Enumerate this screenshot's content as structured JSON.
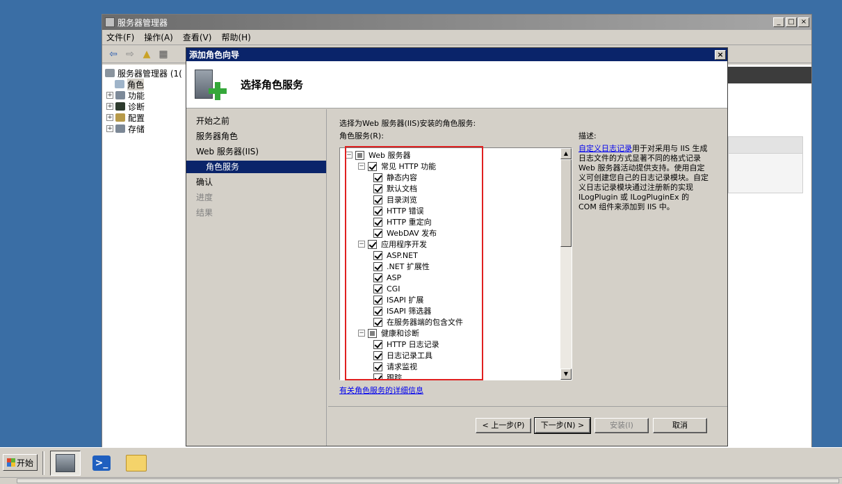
{
  "main_window": {
    "title": "服务器管理器",
    "menu": [
      "文件(F)",
      "操作(A)",
      "查看(V)",
      "帮助(H)"
    ],
    "tree": [
      {
        "label": "服务器管理器 (1(",
        "expander": ""
      },
      {
        "label": "角色",
        "expander": ""
      },
      {
        "label": "功能",
        "expander": "+"
      },
      {
        "label": "诊断",
        "expander": "+"
      },
      {
        "label": "配置",
        "expander": "+"
      },
      {
        "label": "存储",
        "expander": "+"
      }
    ]
  },
  "wizard": {
    "title": "添加角色向导",
    "close": "×",
    "header_title": "选择角色服务",
    "nav": [
      {
        "label": "开始之前",
        "state": "normal"
      },
      {
        "label": "服务器角色",
        "state": "normal"
      },
      {
        "label": "Web 服务器(IIS)",
        "state": "normal"
      },
      {
        "label": "角色服务",
        "state": "active"
      },
      {
        "label": "确认",
        "state": "normal"
      },
      {
        "label": "进度",
        "state": "disabled"
      },
      {
        "label": "结果",
        "state": "disabled"
      }
    ],
    "instruction": "选择为Web 服务器(IIS)安装的角色服务:",
    "list_label": "角色服务(R):",
    "role_services": [
      {
        "label": "Web 服务器",
        "level": 0,
        "toggle": "⊟",
        "check": "partial"
      },
      {
        "label": "常见 HTTP 功能",
        "level": 1,
        "toggle": "⊟",
        "check": "checked"
      },
      {
        "label": "静态内容",
        "level": 2,
        "toggle": "",
        "check": "checked"
      },
      {
        "label": "默认文档",
        "level": 2,
        "toggle": "",
        "check": "checked"
      },
      {
        "label": "目录浏览",
        "level": 2,
        "toggle": "",
        "check": "checked"
      },
      {
        "label": "HTTP 错误",
        "level": 2,
        "toggle": "",
        "check": "checked"
      },
      {
        "label": "HTTP 重定向",
        "level": 2,
        "toggle": "",
        "check": "checked"
      },
      {
        "label": "WebDAV 发布",
        "level": 2,
        "toggle": "",
        "check": "checked"
      },
      {
        "label": "应用程序开发",
        "level": 1,
        "toggle": "⊟",
        "check": "checked"
      },
      {
        "label": "ASP.NET",
        "level": 2,
        "toggle": "",
        "check": "checked"
      },
      {
        "label": ".NET 扩展性",
        "level": 2,
        "toggle": "",
        "check": "checked"
      },
      {
        "label": "ASP",
        "level": 2,
        "toggle": "",
        "check": "checked"
      },
      {
        "label": "CGI",
        "level": 2,
        "toggle": "",
        "check": "checked"
      },
      {
        "label": "ISAPI 扩展",
        "level": 2,
        "toggle": "",
        "check": "checked"
      },
      {
        "label": "ISAPI 筛选器",
        "level": 2,
        "toggle": "",
        "check": "checked"
      },
      {
        "label": "在服务器端的包含文件",
        "level": 2,
        "toggle": "",
        "check": "checked"
      },
      {
        "label": "健康和诊断",
        "level": 1,
        "toggle": "⊟",
        "check": "partial"
      },
      {
        "label": "HTTP 日志记录",
        "level": 2,
        "toggle": "",
        "check": "checked"
      },
      {
        "label": "日志记录工具",
        "level": 2,
        "toggle": "",
        "check": "checked"
      },
      {
        "label": "请求监视",
        "level": 2,
        "toggle": "",
        "check": "checked"
      },
      {
        "label": "跟踪",
        "level": 2,
        "toggle": "",
        "check": "checked"
      }
    ],
    "more_info_link": "有关角色服务的详细信息",
    "description_label": "描述:",
    "description_link": "自定义日志记录",
    "description_text": "用于对采用与 IIS 生成日志文件的方式显著不同的格式记录 Web 服务器活动提供支持。使用自定义可创建您自己的日志记录模块。自定义日志记录模块通过注册新的实现 ILogPlugin 或 ILogPluginEx 的 COM 组件来添加到 IIS 中。",
    "buttons": {
      "prev": "< 上一步(P)",
      "next": "下一步(N) >",
      "install": "安装(I)",
      "cancel": "取消"
    }
  },
  "taskbar": {
    "start": "开始"
  },
  "colors": {
    "desktop": "#3a6ea5",
    "title_active": "#0a246a",
    "highlight_box": "#e02020"
  }
}
